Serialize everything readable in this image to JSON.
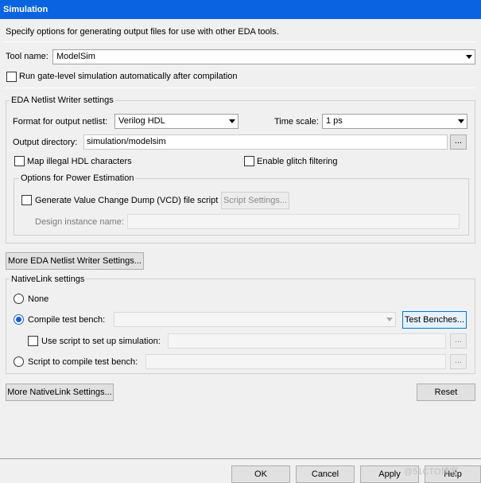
{
  "window": {
    "title": "Simulation",
    "description": "Specify options for generating output files for use with other EDA tools."
  },
  "tool": {
    "label": "Tool name:",
    "value": "ModelSim",
    "run_gate_level_label": "Run gate-level simulation automatically after compilation",
    "run_gate_level_checked": false
  },
  "netlist": {
    "group_title": "EDA Netlist Writer settings",
    "format_label": "Format for output netlist:",
    "format_value": "Verilog HDL",
    "timescale_label": "Time scale:",
    "timescale_value": "1 ps",
    "output_dir_label": "Output directory:",
    "output_dir_value": "simulation/modelsim",
    "browse_label": "...",
    "map_illegal_label": "Map illegal HDL characters",
    "map_illegal_checked": false,
    "glitch_label": "Enable glitch filtering",
    "glitch_checked": false,
    "power": {
      "group_title": "Options for Power Estimation",
      "vcd_label": "Generate Value Change Dump (VCD) file script",
      "vcd_checked": false,
      "script_settings_label": "Script Settings...",
      "instance_label": "Design instance name:",
      "instance_value": ""
    },
    "more_button": "More EDA Netlist Writer Settings..."
  },
  "nativelink": {
    "group_title": "NativeLink settings",
    "none_label": "None",
    "compile_tb_label": "Compile test bench:",
    "compile_tb_value": "",
    "test_benches_button": "Test Benches...",
    "use_script_label": "Use script to set up simulation:",
    "use_script_value": "",
    "script_compile_label": "Script to compile test bench:",
    "script_compile_value": "",
    "browse_label": "...",
    "selected": "compile_tb",
    "more_button": "More NativeLink Settings...",
    "reset_button": "Reset"
  },
  "footer": {
    "ok": "OK",
    "cancel": "Cancel",
    "apply": "Apply",
    "help": "Help",
    "watermark": "@51CTO博客"
  },
  "colors": {
    "titlebar": "#0a63e0",
    "accent": "#1a5fd0"
  }
}
